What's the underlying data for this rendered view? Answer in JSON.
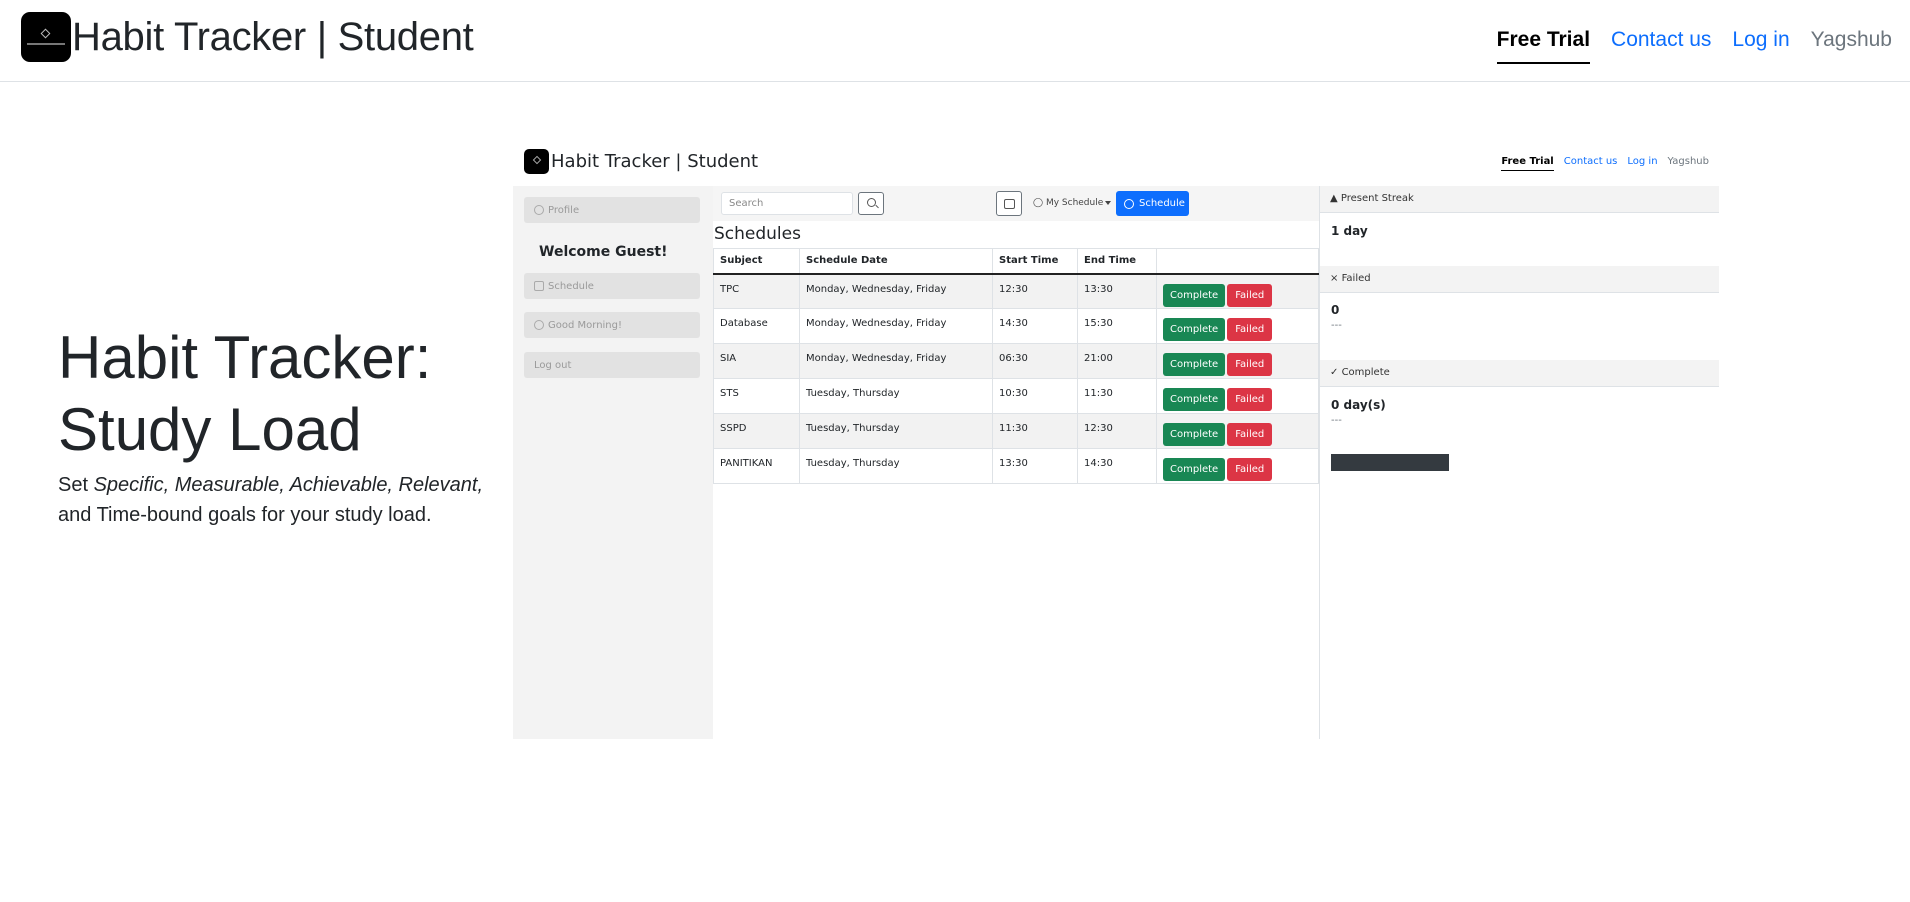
{
  "header": {
    "brand": "Habit Tracker | Student",
    "nav": {
      "free_trial": "Free Trial",
      "contact": "Contact us",
      "login": "Log in",
      "yagshub": "Yagshub"
    }
  },
  "hero": {
    "title_line1": "Habit Tracker:",
    "title_line2": "Study Load",
    "desc_prefix": "Set ",
    "desc_italic": "Specific, Measurable, Achievable, Relevant,",
    "desc_suffix": " and Time-bound goals for your study load."
  },
  "preview": {
    "brand": "Habit Tracker | Student",
    "nav": {
      "free_trial": "Free Trial",
      "contact": "Contact us",
      "login": "Log in",
      "yagshub": "Yagshub"
    },
    "sidebar": {
      "profile": "Profile",
      "welcome": "Welcome Guest!",
      "schedule": "Schedule",
      "greeting": "Good Morning!",
      "logout": "Log out"
    },
    "toolbar": {
      "search_placeholder": "Search",
      "my_schedule": "My Schedule",
      "schedule_button": "Schedule"
    },
    "schedules_title": "Schedules",
    "table": {
      "headers": [
        "Subject",
        "Schedule Date",
        "Start Time",
        "End Time"
      ],
      "complete_label": "Complete",
      "failed_label": "Failed",
      "rows": [
        {
          "subject": "TPC",
          "date": "Monday, Wednesday, Friday",
          "start": "12:30",
          "end": "13:30"
        },
        {
          "subject": "Database",
          "date": "Monday, Wednesday, Friday",
          "start": "14:30",
          "end": "15:30"
        },
        {
          "subject": "SIA",
          "date": "Monday, Wednesday, Friday",
          "start": "06:30",
          "end": "21:00"
        },
        {
          "subject": "STS",
          "date": "Tuesday, Thursday",
          "start": "10:30",
          "end": "11:30"
        },
        {
          "subject": "SSPD",
          "date": "Tuesday, Thursday",
          "start": "11:30",
          "end": "12:30"
        },
        {
          "subject": "PANITIKAN",
          "date": "Tuesday, Thursday",
          "start": "13:30",
          "end": "14:30"
        }
      ]
    },
    "stats": {
      "streak_label": "Present Streak",
      "streak_value": "1 day",
      "failed_label": "Failed",
      "failed_value": "0",
      "failed_detail": "---",
      "complete_label": "Complete",
      "complete_value": "0 day(s)",
      "complete_detail": "---"
    }
  }
}
